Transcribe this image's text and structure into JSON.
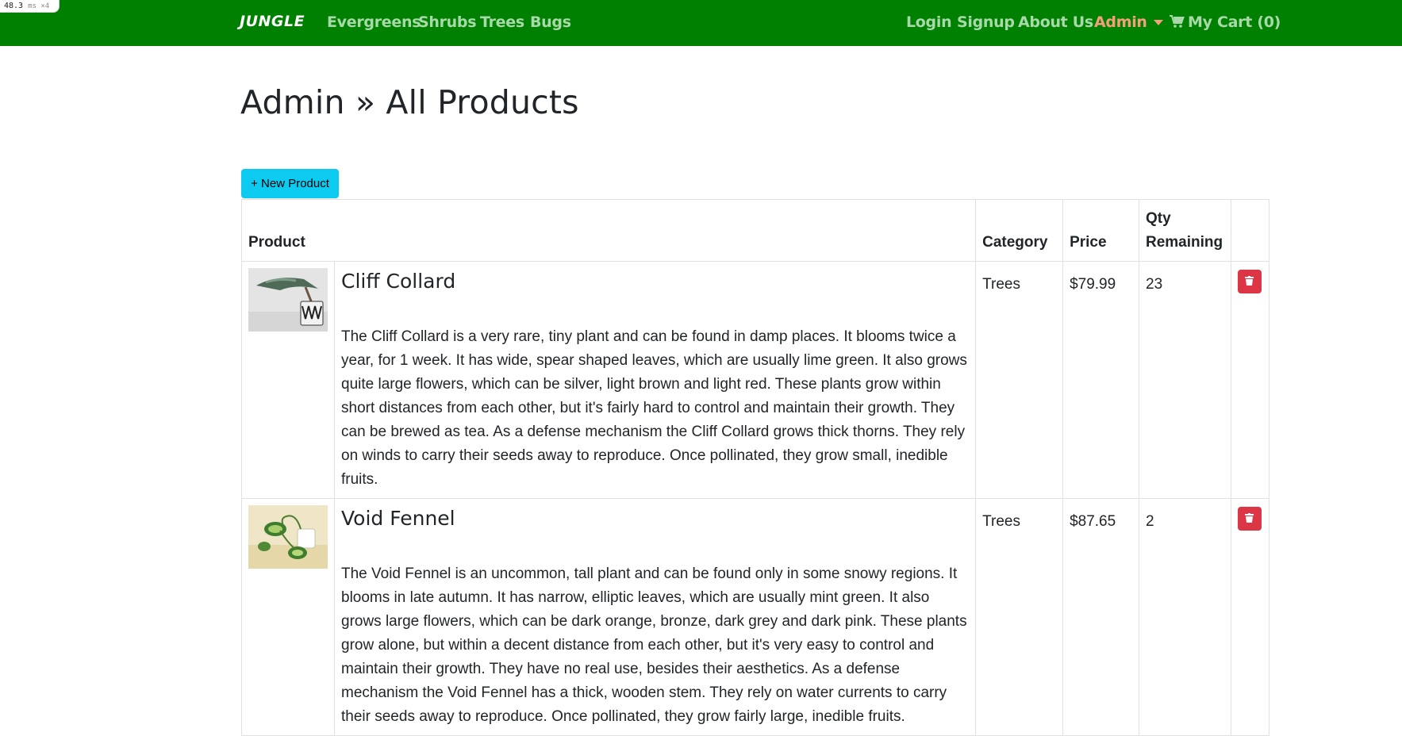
{
  "perf": {
    "value": "48.3",
    "unit": "ms ×4"
  },
  "nav": {
    "brand": "JUNGLE",
    "left_links": [
      "Evergreens",
      "Shrubs",
      "Trees",
      "Bugs"
    ],
    "login": "Login",
    "signup": "Signup",
    "about": "About Us",
    "admin": "Admin",
    "cart": "My Cart (0)"
  },
  "colors": {
    "navbar": "#008000",
    "nav_link": "#a8d9a8",
    "admin_link": "#f4a07c",
    "new_button": "#0dcaf0",
    "delete_button": "#dc3545"
  },
  "page": {
    "title": "Admin » All Products",
    "new_button": "+ New Product"
  },
  "table": {
    "headers": {
      "product": "Product",
      "category": "Category",
      "price": "Price",
      "qty_line1": "Qty",
      "qty_line2": "Remaining"
    },
    "rows": [
      {
        "name": "Cliff Collard",
        "description": "The Cliff Collard is a very rare, tiny plant and can be found in damp places. It blooms twice a year, for 1 week. It has wide, spear shaped leaves, which are usually lime green. It also grows quite large flowers, which can be silver, light brown and light red. These plants grow within short distances from each other, but it's fairly hard to control and maintain their growth. They can be brewed as tea. As a defense mechanism the Cliff Collard grows thick thorns. They rely on winds to carry their seeds away to reproduce. Once pollinated, they grow small, inedible fruits.",
        "category": "Trees",
        "price": "$79.99",
        "qty": "23",
        "delete_icon": "trash-icon"
      },
      {
        "name": "Void Fennel",
        "description": "The Void Fennel is an uncommon, tall plant and can be found only in some snowy regions. It blooms in late autumn. It has narrow, elliptic leaves, which are usually mint green. It also grows large flowers, which can be dark orange, bronze, dark grey and dark pink. These plants grow alone, but within a decent distance from each other, but it's very easy to control and maintain their growth. They have no real use, besides their aesthetics. As a defense mechanism the Void Fennel has a thick, wooden stem. They rely on water currents to carry their seeds away to reproduce. Once pollinated, they grow fairly large, inedible fruits.",
        "category": "Trees",
        "price": "$87.65",
        "qty": "2",
        "delete_icon": "trash-icon"
      }
    ]
  }
}
